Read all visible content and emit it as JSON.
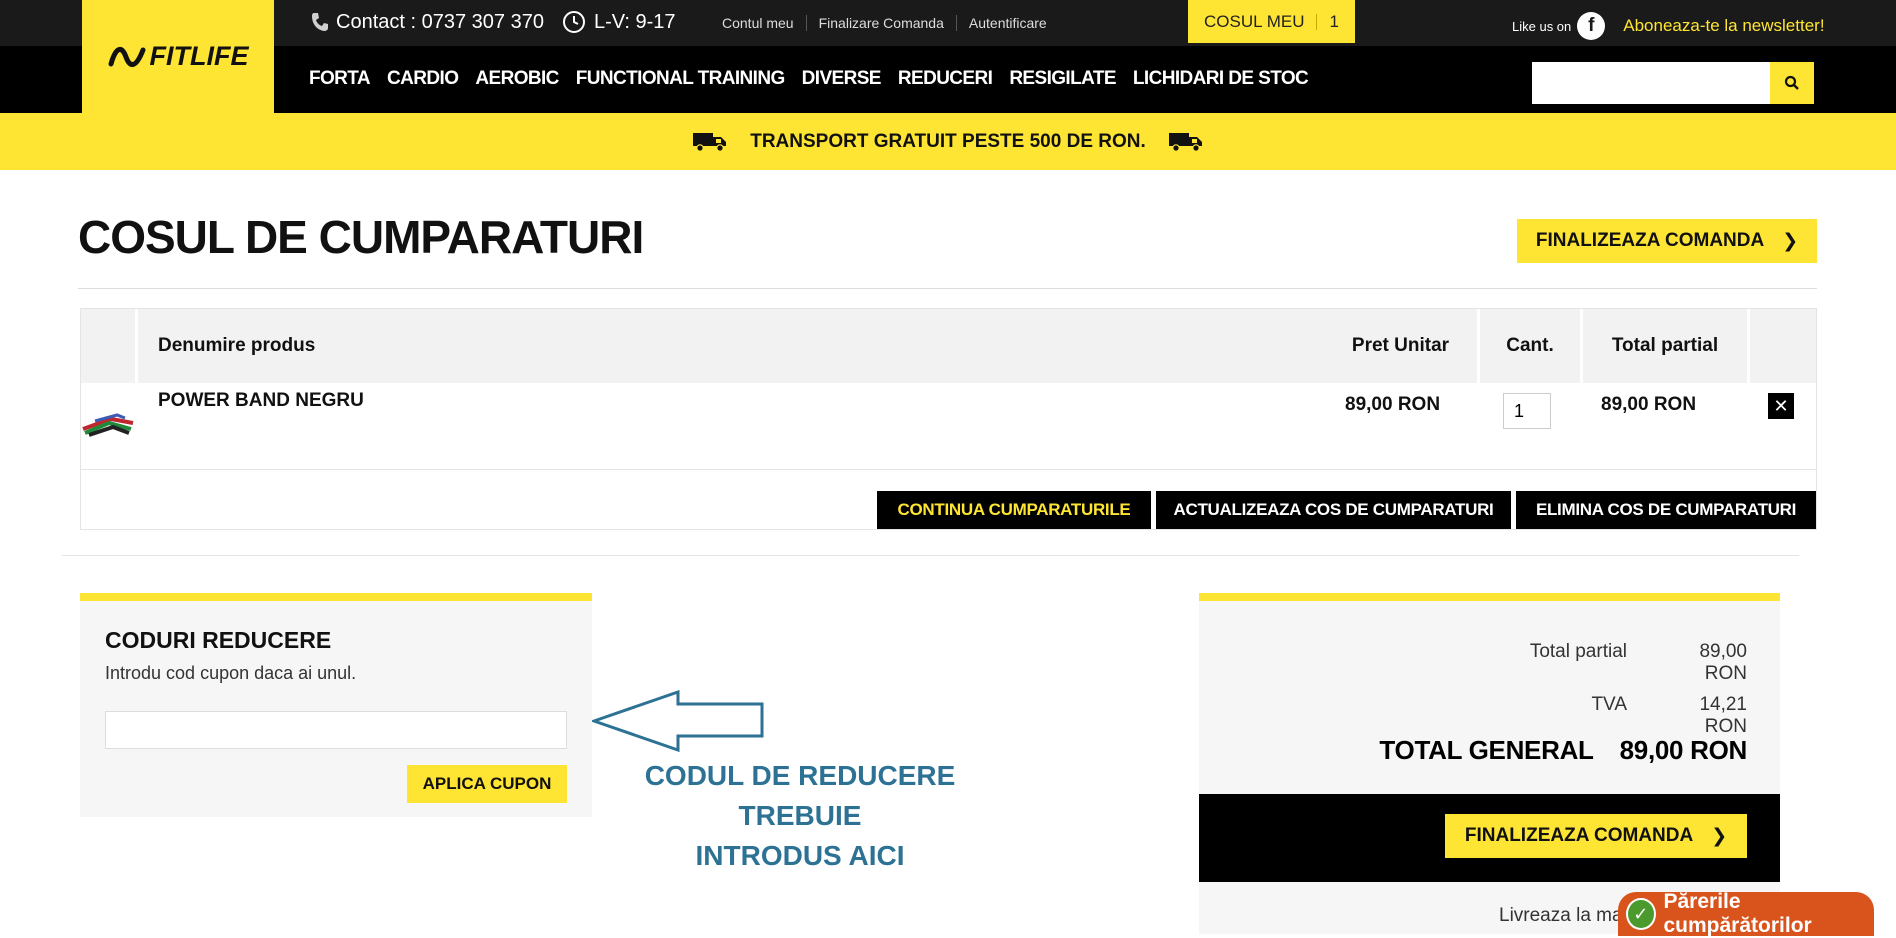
{
  "header": {
    "brand": "FITLIFE",
    "contact": "Contact : 0737 307 370",
    "hours": "L-V: 9-17",
    "links": [
      "Contul meu",
      "Finalizare Comanda",
      "Autentificare"
    ],
    "cart_label": "COSUL MEU",
    "cart_count": "1",
    "like_text": "Like us on",
    "facebook_letter": "f",
    "newsletter": "Aboneaza-te la newsletter!",
    "menu": [
      "FORTA",
      "CARDIO",
      "AEROBIC",
      "FUNCTIONAL TRAINING",
      "DIVERSE",
      "REDUCERI",
      "RESIGILATE",
      "LICHIDARI DE STOC"
    ],
    "search_placeholder": ""
  },
  "promo": {
    "text": "TRANSPORT GRATUIT PESTE 500 DE RON."
  },
  "cart": {
    "title": "COSUL DE CUMPARATURI",
    "finalize_label": "FINALIZEAZA COMANDA",
    "columns": {
      "name": "Denumire produs",
      "price": "Pret Unitar",
      "qty": "Cant.",
      "subtotal": "Total partial"
    },
    "items": [
      {
        "name": "POWER BAND NEGRU",
        "price": "89,00 RON",
        "qty": "1",
        "subtotal": "89,00 RON",
        "remove": "✕"
      }
    ],
    "actions": {
      "continue": "CONTINUA CUMPARATURILE",
      "update": "ACTUALIZEAZA COS DE CUMPARATURI",
      "clear": "ELIMINA COS DE CUMPARATURI"
    }
  },
  "coupon": {
    "title": "CODURI REDUCERE",
    "hint": "Introdu cod cupon daca ai unul.",
    "value": "",
    "apply": "APLICA CUPON"
  },
  "annotation": {
    "line1": "CODUL DE REDUCERE TREBUIE",
    "line2": "INTRODUS AICI",
    "color": "#2d7294"
  },
  "totals": {
    "subtotal_label": "Total partial",
    "subtotal_value": "89,00 RON",
    "vat_label": "TVA",
    "vat_value": "14,21 RON",
    "grand_label": "TOTAL GENERAL",
    "grand_value": "89,00 RON",
    "finalize_label": "FINALIZEAZA COMANDA",
    "deliver_text": "Livreaza la ma"
  },
  "reviews_badge": "Părerile cumpărătorilor",
  "colors": {
    "accent": "#ffe533",
    "dark": "#000000",
    "annotation": "#2d7294",
    "reviews": "#d9541c"
  }
}
